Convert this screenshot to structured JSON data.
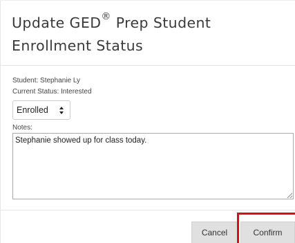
{
  "dialog": {
    "title_main": "Update GED",
    "title_sup": "®",
    "title_rest": " Prep Student Enrollment Status"
  },
  "student": {
    "name_line": "Student: Stephanie Ly",
    "status_line": "Current Status: Interested"
  },
  "status_select": {
    "selected": "Enrolled"
  },
  "notes": {
    "label": "Notes:",
    "value": "Stephanie showed up for class today."
  },
  "footer": {
    "cancel_label": "Cancel",
    "confirm_label": "Confirm"
  },
  "colors": {
    "highlight": "#ff0000",
    "button_bg": "#e0e0e0"
  }
}
